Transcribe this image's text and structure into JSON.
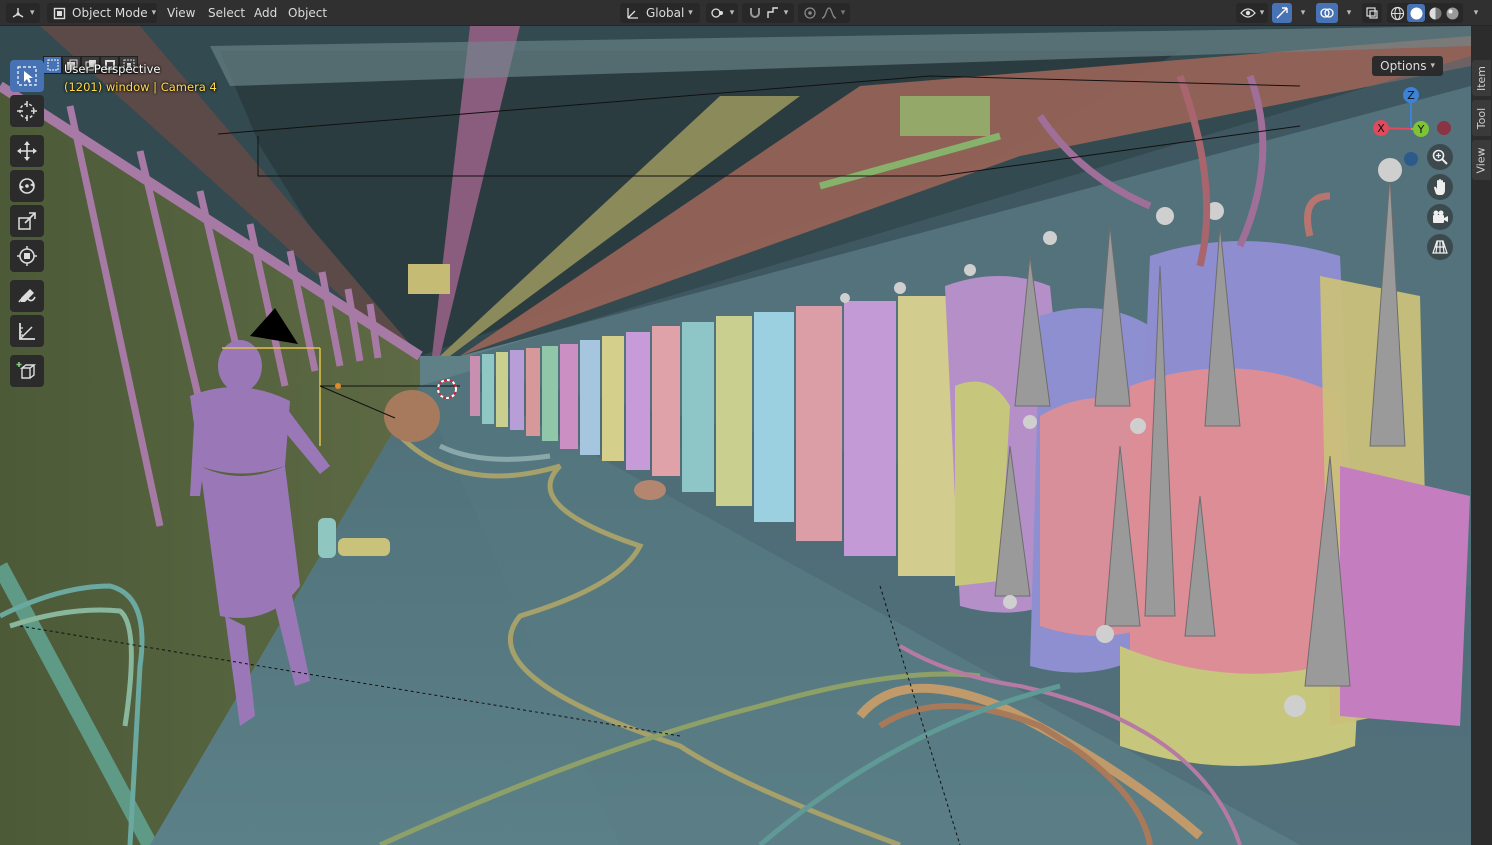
{
  "header": {
    "editor_type_icon": "editor-type-3d-viewport-icon",
    "mode_label": "Object Mode",
    "menus": [
      "View",
      "Select",
      "Add",
      "Object"
    ],
    "transform_orientation": "Global",
    "options_label": "Options"
  },
  "viewport": {
    "title": "User Perspective",
    "subtitle": "(1201) window | Camera 4",
    "gizmo_axes": [
      "X",
      "Y",
      "Z"
    ],
    "accent_color": "#4772b3",
    "axis_colors": {
      "x": "#e04a5c",
      "y": "#7fc436",
      "z": "#3d82d6"
    }
  },
  "toolbar": {
    "tools": [
      "select-box-icon",
      "cursor-icon",
      "move-icon",
      "rotate-icon",
      "scale-icon",
      "transform-icon",
      "annotate-icon",
      "measure-icon",
      "add-cube-icon"
    ]
  },
  "navigation": [
    "zoom-icon",
    "pan-hand-icon",
    "camera-view-icon",
    "ortho-grid-icon"
  ],
  "npanel": {
    "tabs": [
      "Item",
      "Tool",
      "View"
    ]
  }
}
